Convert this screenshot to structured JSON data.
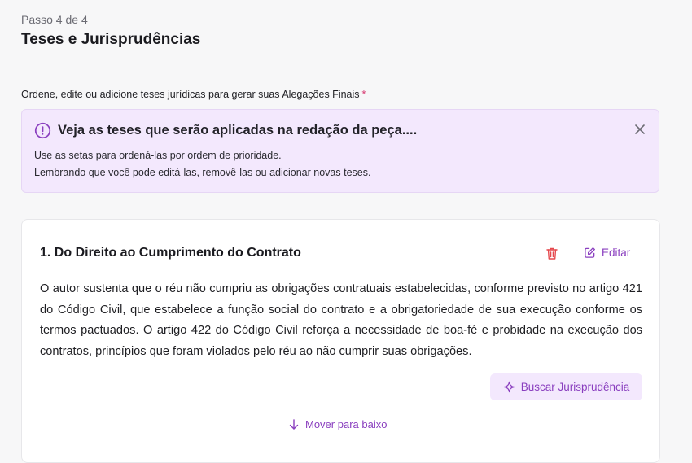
{
  "header": {
    "step": "Passo 4 de 4",
    "title": "Teses e Jurisprudências"
  },
  "instruction": {
    "text": "Ordene, edite ou adicione teses jurídicas para gerar suas Alegações Finais",
    "required_mark": "*"
  },
  "alert": {
    "icon": "alert-circle-icon",
    "title": "Veja as teses que serão aplicadas na redação da peça....",
    "line1": "Use as setas para ordená-las por ordem de prioridade.",
    "line2": "Lembrando que você pode editá-las, removê-las ou adicionar novas teses.",
    "close_icon": "close-icon"
  },
  "thesis": {
    "title": "1. Do Direito ao Cumprimento do Contrato",
    "delete_icon": "trash-icon",
    "edit_label": "Editar",
    "body": "O autor sustenta que o réu não cumpriu as obrigações contratuais estabelecidas, conforme previsto no artigo 421 do Código Civil, que estabelece a função social do contrato e a obrigatoriedade de sua execução conforme os termos pactuados. O artigo 422 do Código Civil reforça a necessidade de boa-fé e probidade na execução dos contratos, princípios que foram violados pelo réu ao não cumprir suas obrigações.",
    "search_label": "Buscar Jurisprudência",
    "move_down_label": "Mover para baixo"
  },
  "colors": {
    "accent": "#8a3fbf",
    "alert_bg": "#f3e8fd",
    "danger": "#e5484d",
    "page_bg": "#f7f7f8"
  }
}
